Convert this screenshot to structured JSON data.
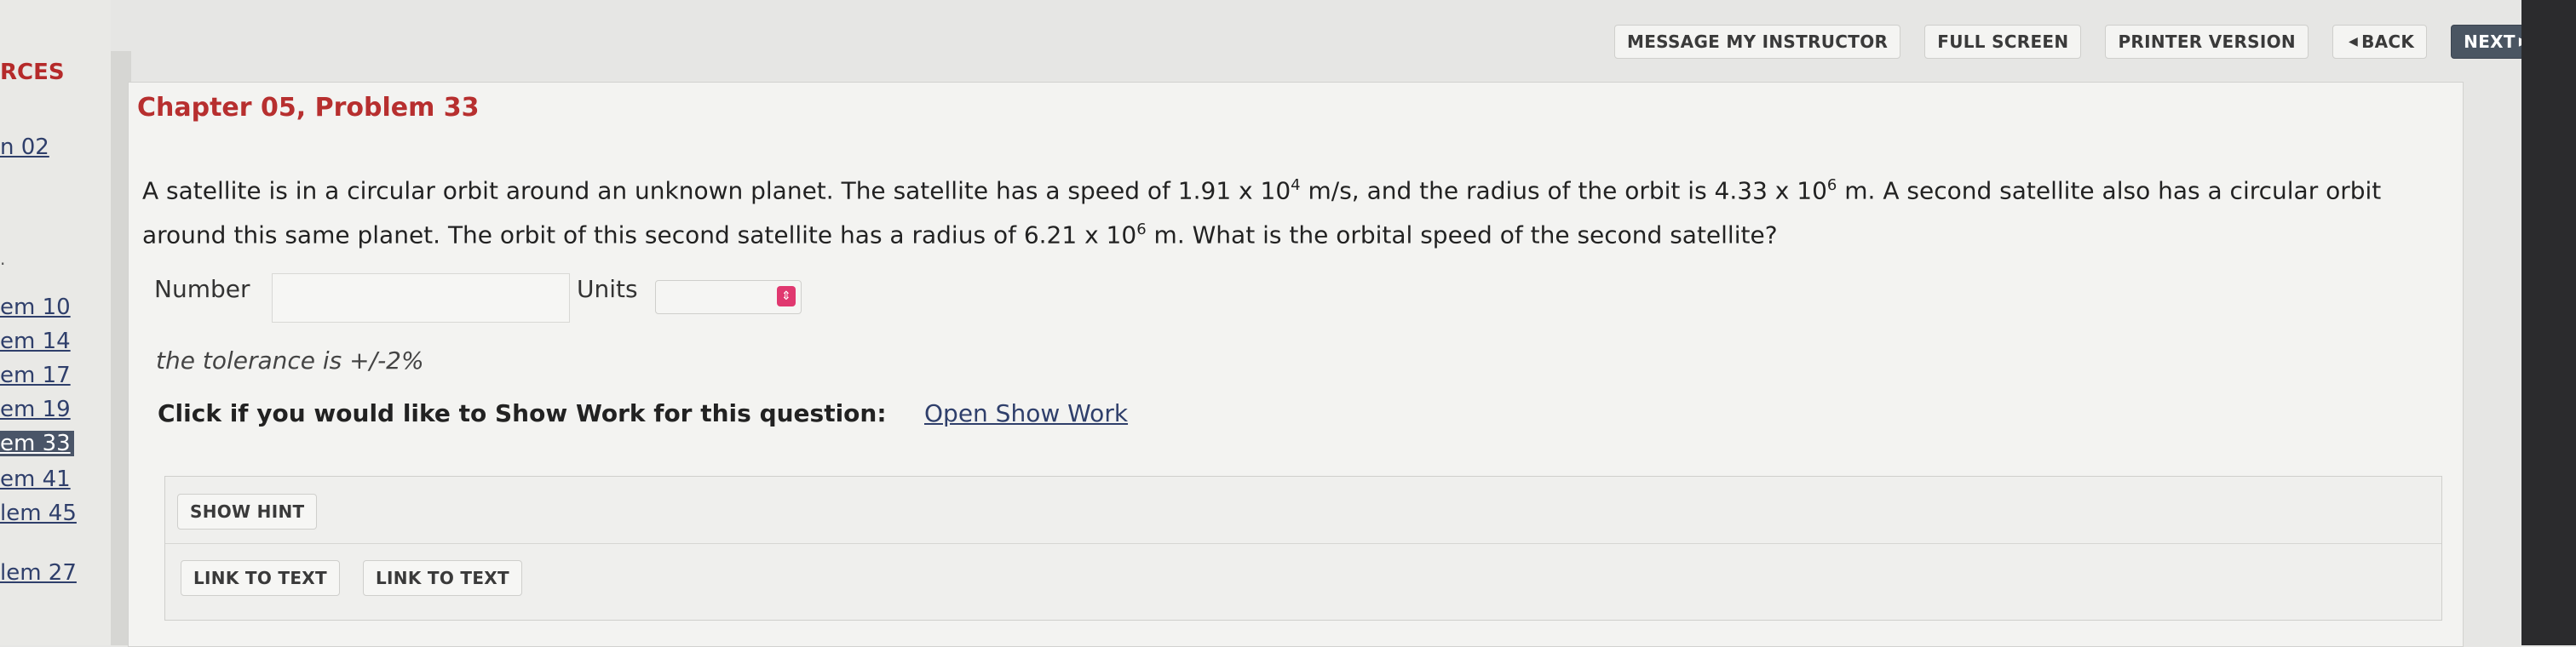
{
  "toolbar": {
    "message": "MESSAGE MY INSTRUCTOR",
    "fullscreen": "FULL SCREEN",
    "printer": "PRINTER VERSION",
    "back": "BACK",
    "next": "NEXT"
  },
  "sidebar": {
    "title": "RCES",
    "items": [
      {
        "label": "n 02"
      },
      {
        "label": "em 10"
      },
      {
        "label": "em 14"
      },
      {
        "label": "em 17"
      },
      {
        "label": "em 19"
      },
      {
        "label": "em 33"
      },
      {
        "label": "em 41"
      },
      {
        "label": "lem 45"
      },
      {
        "label": "lem 27"
      }
    ]
  },
  "main": {
    "chapter_title": "Chapter 05, Problem 33",
    "question": {
      "p1": "A satellite is in a circular orbit around an unknown planet. The satellite has a speed of 1.91 x 10",
      "exp1": "4",
      "p2": " m/s, and the radius of the orbit is 4.33 x 10",
      "exp2": "6",
      "p3": " m. A second satellite also has a circular orbit around this same planet. The orbit of this second satellite has a radius of 6.21 x 10",
      "exp3": "6",
      "p4": " m. What is the orbital speed of the second satellite?"
    },
    "number_label": "Number",
    "number_value": "",
    "units_label": "Units",
    "units_value": "",
    "tolerance": "the tolerance is +/-2%",
    "showwork_label": "Click if you would like to Show Work for this question:",
    "showwork_link": "Open Show Work",
    "show_hint": "SHOW HINT",
    "link_to_text_1": "LINK TO TEXT",
    "link_to_text_2": "LINK TO TEXT"
  }
}
